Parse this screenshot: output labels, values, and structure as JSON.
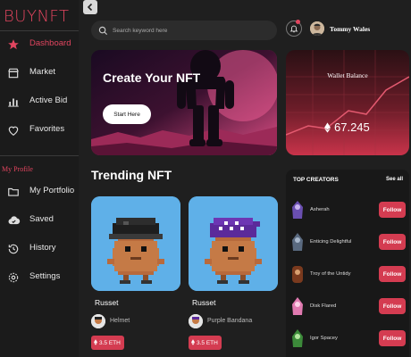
{
  "brand": "BUYNFT",
  "sidebar": {
    "items": [
      {
        "label": "Dashboard",
        "icon": "star-icon"
      },
      {
        "label": "Market",
        "icon": "store-icon"
      },
      {
        "label": "Active Bid",
        "icon": "bar-chart-icon"
      },
      {
        "label": "Favorites",
        "icon": "heart-icon"
      }
    ],
    "section_label": "My Profile",
    "profile_items": [
      {
        "label": "My Portfolio",
        "icon": "folder-icon"
      },
      {
        "label": "Saved",
        "icon": "cloud-check-icon"
      },
      {
        "label": "History",
        "icon": "history-icon"
      },
      {
        "label": "Settings",
        "icon": "gear-icon"
      }
    ]
  },
  "header": {
    "search_placeholder": "Search keyword here",
    "user_name": "Tommy Wales"
  },
  "hero": {
    "title": "Create Your NFT",
    "button_label": "Start Here"
  },
  "wallet": {
    "label": "Wallet Balance",
    "amount": "67.245"
  },
  "trending": {
    "title": "Trending NFT",
    "cards": [
      {
        "name": "Russet",
        "owner": "Helmet",
        "price": "3.5 ETH"
      },
      {
        "name": "Russet",
        "owner": "Purple Bandana",
        "price": "3.5 ETH"
      }
    ]
  },
  "creators": {
    "title": "TOP CREATORS",
    "see_all": "See all",
    "follow_label": "Follow",
    "items": [
      {
        "name": "Asherah"
      },
      {
        "name": "Enticing Delightful"
      },
      {
        "name": "Troy of the Untidy"
      },
      {
        "name": "Disk Flared"
      },
      {
        "name": "Igor Spacey"
      }
    ]
  },
  "colors": {
    "accent": "#e2455f",
    "button": "#d43c51",
    "background": "#1f1f1f",
    "card_blue": "#5fb0e8"
  }
}
